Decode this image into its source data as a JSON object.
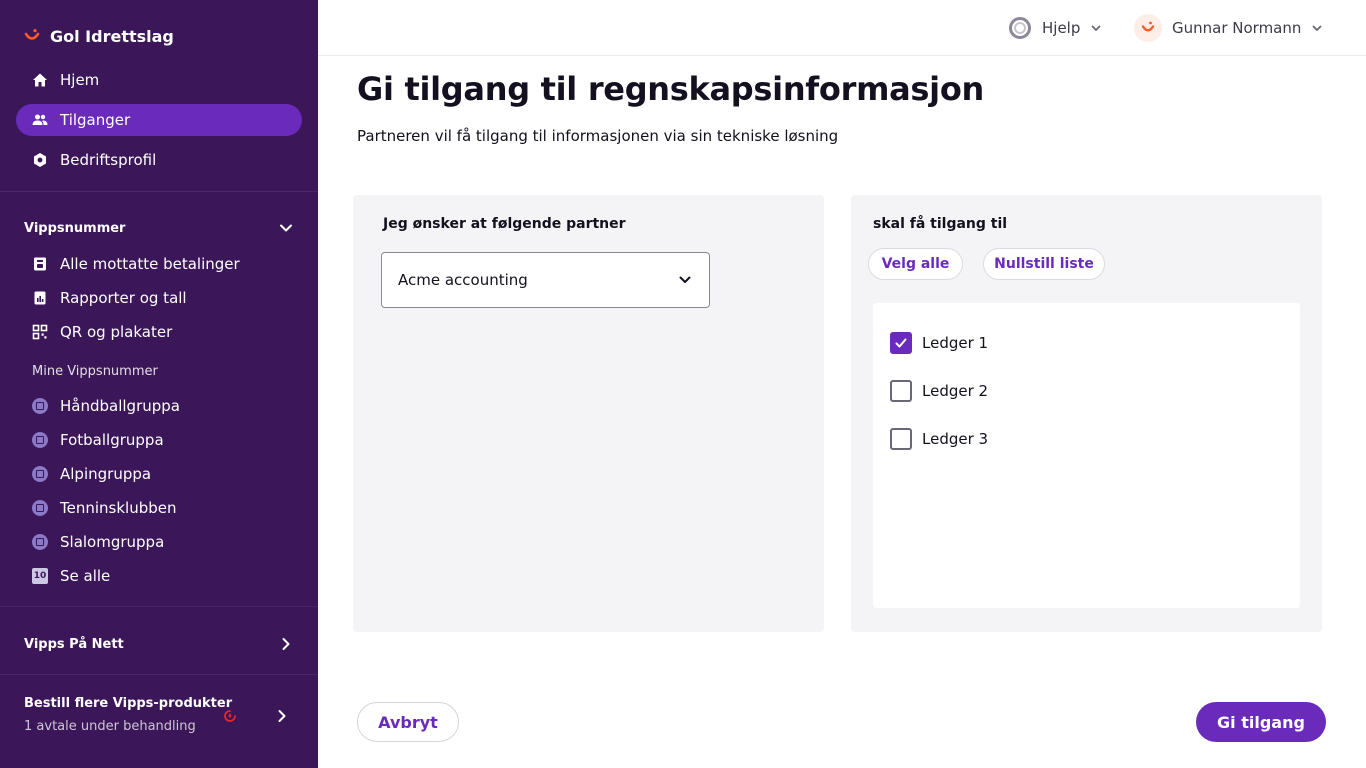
{
  "sidebar": {
    "brand": "Gol Idrettslag",
    "nav": [
      {
        "label": "Hjem",
        "icon": "home-icon"
      },
      {
        "label": "Tilganger",
        "icon": "users-icon",
        "active": true
      },
      {
        "label": "Bedriftsprofil",
        "icon": "settings-icon"
      }
    ],
    "vippsnummer": {
      "title": "Vippsnummer",
      "items": [
        {
          "label": "Alle mottatte betalinger",
          "icon": "payments-icon"
        },
        {
          "label": "Rapporter og tall",
          "icon": "reports-icon"
        },
        {
          "label": "QR og plakater",
          "icon": "qr-icon"
        }
      ],
      "mine_label": "Mine Vippsnummer",
      "mine": [
        {
          "label": "Håndballgruppa"
        },
        {
          "label": "Fotballgruppa"
        },
        {
          "label": "Alpingruppa"
        },
        {
          "label": "Tenninsklubben"
        },
        {
          "label": "Slalomgruppa"
        }
      ],
      "see_all": {
        "label": "Se alle",
        "badge": "10"
      }
    },
    "vipps_pa_nett": "Vipps På Nett",
    "order": {
      "title": "Bestill flere Vipps-produkter",
      "subtitle": "1 avtale under behandling"
    }
  },
  "header": {
    "help": "Hjelp",
    "user": "Gunnar Normann"
  },
  "main": {
    "title": "Gi tilgang til regnskapsinformasjon",
    "subtitle": "Partneren vil få tilgang til informasjonen via sin tekniske løsning",
    "left_panel": {
      "label": "Jeg ønsker at følgende partner",
      "selected_partner": "Acme accounting"
    },
    "right_panel": {
      "label": "skal få tilgang til",
      "select_all": "Velg alle",
      "reset": "Nullstill liste",
      "ledgers": [
        {
          "label": "Ledger 1",
          "checked": true
        },
        {
          "label": "Ledger 2",
          "checked": false
        },
        {
          "label": "Ledger 3",
          "checked": false
        }
      ]
    },
    "cancel_label": "Avbryt",
    "submit_label": "Gi tilgang"
  },
  "colors": {
    "sidebar_bg": "#3b1659",
    "accent": "#6a2bbd",
    "brand_orange": "#ff5b24"
  }
}
